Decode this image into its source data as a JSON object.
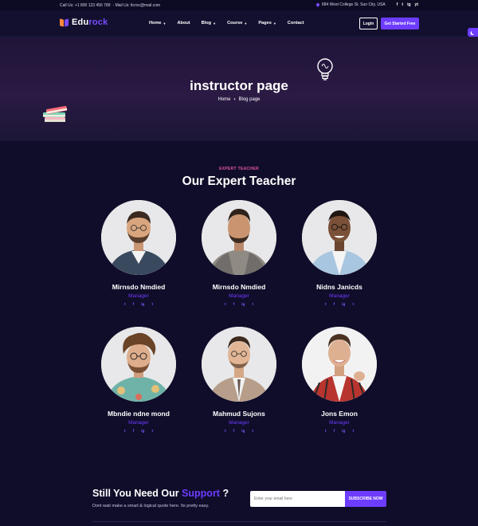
{
  "topbar": {
    "call": "Call Us: +1 800 123 456 789",
    "mail": "- Mail Us: ltcroc@mail.com",
    "address": "684 West College St. Sun City, USA",
    "social": [
      "f",
      "t",
      "ig",
      "yt"
    ]
  },
  "header": {
    "logo_part1": "Edu",
    "logo_part2": "rock",
    "nav": [
      {
        "label": "Home",
        "dropdown": true
      },
      {
        "label": "About",
        "dropdown": false
      },
      {
        "label": "Blog",
        "dropdown": true
      },
      {
        "label": "Course",
        "dropdown": true
      },
      {
        "label": "Pages",
        "dropdown": true
      },
      {
        "label": "Contact",
        "dropdown": false
      }
    ],
    "login": "Login",
    "cta": "Get Started Free"
  },
  "hero": {
    "title": "instructor page",
    "breadcrumb_home": "Home",
    "breadcrumb_sep": "›",
    "breadcrumb_current": "Blog page"
  },
  "team": {
    "eyebrow": "EXPERT TEACHER",
    "title": "Our Expert Teacher",
    "members": [
      {
        "name": "Mirnsdo Nmdied",
        "role": "Manager"
      },
      {
        "name": "Mirnsdo Nmdied",
        "role": "Manager"
      },
      {
        "name": "Nidns Janicds",
        "role": "Manager"
      },
      {
        "name": "Mbndie ndne mond",
        "role": "Manager"
      },
      {
        "name": "Mahmud Sujons",
        "role": "Manager"
      },
      {
        "name": "Jons Emon",
        "role": "Manager"
      }
    ],
    "social": [
      "t",
      "f",
      "ig",
      "t"
    ]
  },
  "newsletter": {
    "title_prefix": "Still You Need Our ",
    "title_accent": "Support",
    "title_suffix": " ?",
    "subtitle": "Dont wait make a smart & logical quote here. Its pretty easy.",
    "placeholder": "Enter your email here",
    "button": "SUBSCRIBE NOW"
  },
  "colors": {
    "background": "#100d2a",
    "accent": "#6d3cff",
    "eyebrow": "#e4569a"
  }
}
